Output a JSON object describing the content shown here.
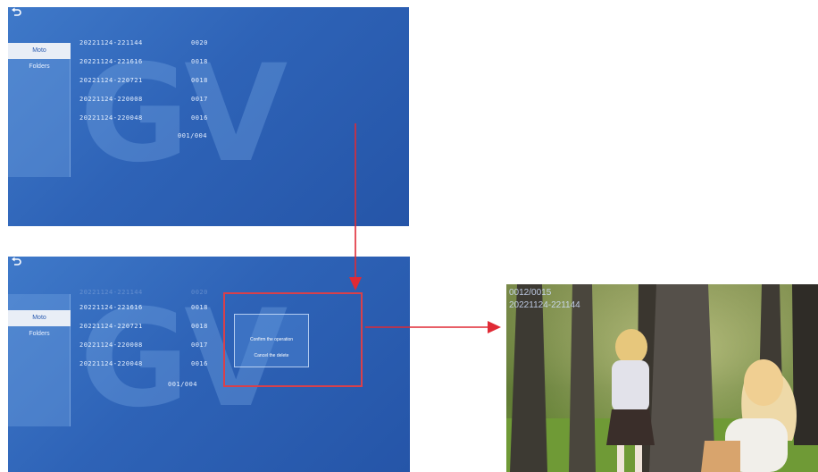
{
  "screens": {
    "top": {
      "sidebar": [
        {
          "label": "Moto",
          "active": true
        },
        {
          "label": "Folders",
          "active": false
        }
      ],
      "files": [
        {
          "name": "20221124-221144",
          "num": "0020"
        },
        {
          "name": "20221124-221616",
          "num": "0018"
        },
        {
          "name": "20221124-220721",
          "num": "0018"
        },
        {
          "name": "20221124-220008",
          "num": "0017"
        },
        {
          "name": "20221124-220048",
          "num": "0016"
        }
      ],
      "page_counter": "001/004",
      "watermark": "GV"
    },
    "bottom": {
      "sidebar": [
        {
          "label": "Moto",
          "active": true
        },
        {
          "label": "Folders",
          "active": false
        }
      ],
      "files_faded": {
        "name": "20221124-221144",
        "num": "0020"
      },
      "files": [
        {
          "name": "20221124-221616",
          "num": "0018"
        },
        {
          "name": "20221124-220721",
          "num": "0018"
        },
        {
          "name": "20221124-220008",
          "num": "0017"
        },
        {
          "name": "20221124-220048",
          "num": "0016"
        }
      ],
      "page_counter": "001/004",
      "watermark": "GV",
      "popup": {
        "option_1": "Confirm the operation",
        "option_2": "Cancel the delete"
      }
    }
  },
  "photo": {
    "index": "0012/0015",
    "name": "20221124-221144"
  },
  "colors": {
    "screen_blue": "#2e63b7",
    "highlight_red": "#d9404a",
    "arrow_red": "#e02a35"
  }
}
